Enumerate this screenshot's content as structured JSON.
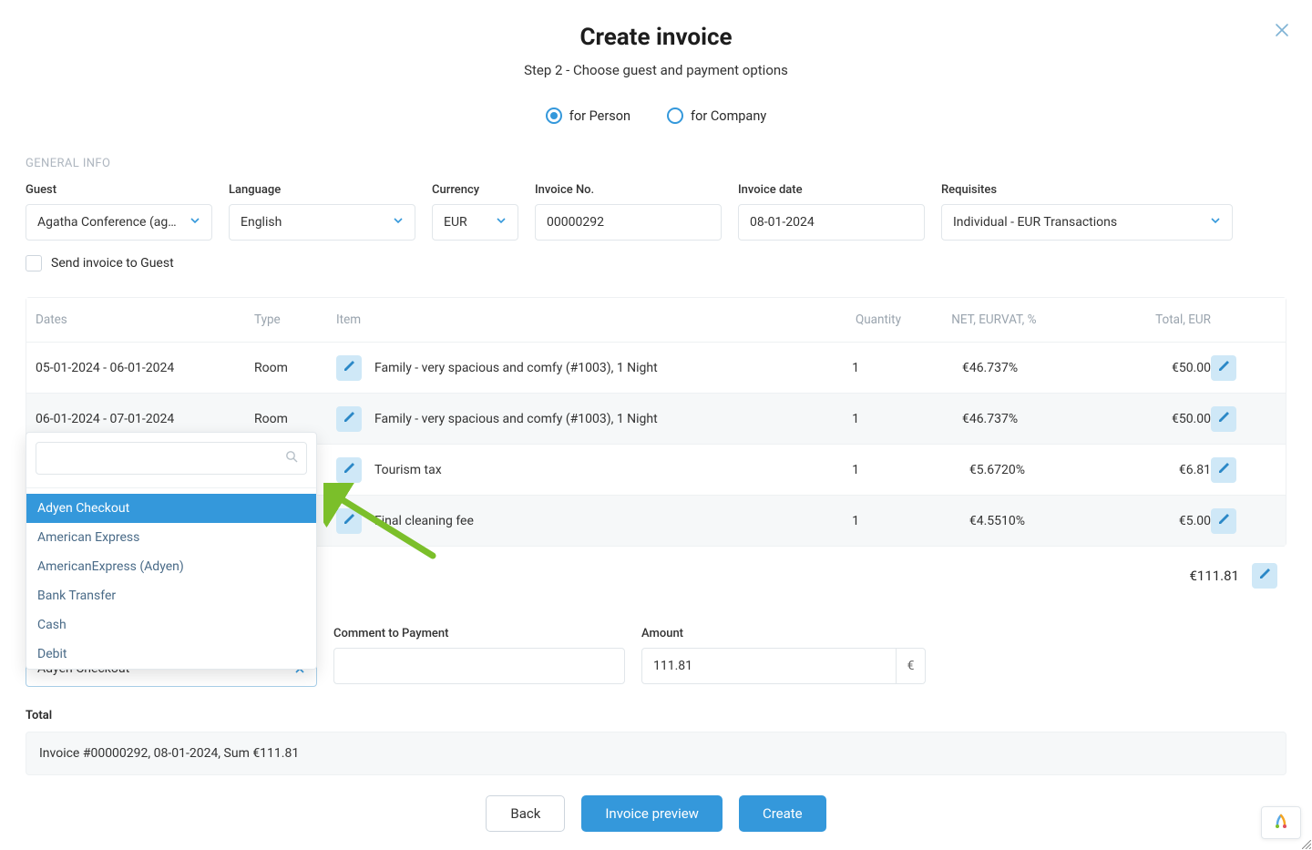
{
  "header": {
    "title": "Create invoice",
    "subtitle": "Step 2 - Choose guest and payment options",
    "radios": {
      "person": "for Person",
      "company": "for Company"
    }
  },
  "section_caption": "GENERAL INFO",
  "labels": {
    "guest": "Guest",
    "language": "Language",
    "currency": "Currency",
    "invoice_no": "Invoice No.",
    "invoice_date": "Invoice date",
    "requisites": "Requisites",
    "send_invoice": "Send invoice to Guest",
    "comment": "Comment to Payment",
    "amount": "Amount",
    "total": "Total"
  },
  "values": {
    "guest": "Agatha Conference (agaco…",
    "language": "English",
    "currency": "EUR",
    "invoice_no": "00000292",
    "invoice_date": "08-01-2024",
    "requisites": "Individual - EUR Transactions",
    "amount": "111.81",
    "amount_currency": "€",
    "payment_method_selected": "Adyen Checkout"
  },
  "table": {
    "headers": {
      "dates": "Dates",
      "type": "Type",
      "item": "Item",
      "quantity": "Quantity",
      "net": "NET, EUR",
      "vat": "VAT, %",
      "total": "Total, EUR"
    },
    "rows": [
      {
        "dates": "05-01-2024 - 06-01-2024",
        "type": "Room",
        "item": "Family - very spacious and comfy  (#1003), 1 Night",
        "quantity": "1",
        "net": "€46.73",
        "vat": "7%",
        "total": "€50.00"
      },
      {
        "dates": "06-01-2024 - 07-01-2024",
        "type": "Room",
        "item": "Family - very spacious and comfy  (#1003), 1 Night",
        "quantity": "1",
        "net": "€46.73",
        "vat": "7%",
        "total": "€50.00"
      },
      {
        "dates": "",
        "type": "",
        "item": "Tourism tax",
        "quantity": "1",
        "net": "€5.67",
        "vat": "20%",
        "total": "€6.81"
      },
      {
        "dates": "",
        "type": "",
        "item": "Final cleaning fee",
        "quantity": "1",
        "net": "€4.55",
        "vat": "10%",
        "total": "€5.00"
      }
    ],
    "grand_total": "€111.81"
  },
  "dropdown": {
    "search": "",
    "options": [
      "Adyen Checkout",
      "American Express",
      "AmericanExpress (Adyen)",
      "Bank Transfer",
      "Cash",
      "Debit"
    ],
    "selected_index": 0
  },
  "summary_text": "Invoice #00000292, 08-01-2024, Sum €111.81",
  "buttons": {
    "back": "Back",
    "preview": "Invoice preview",
    "create": "Create"
  }
}
